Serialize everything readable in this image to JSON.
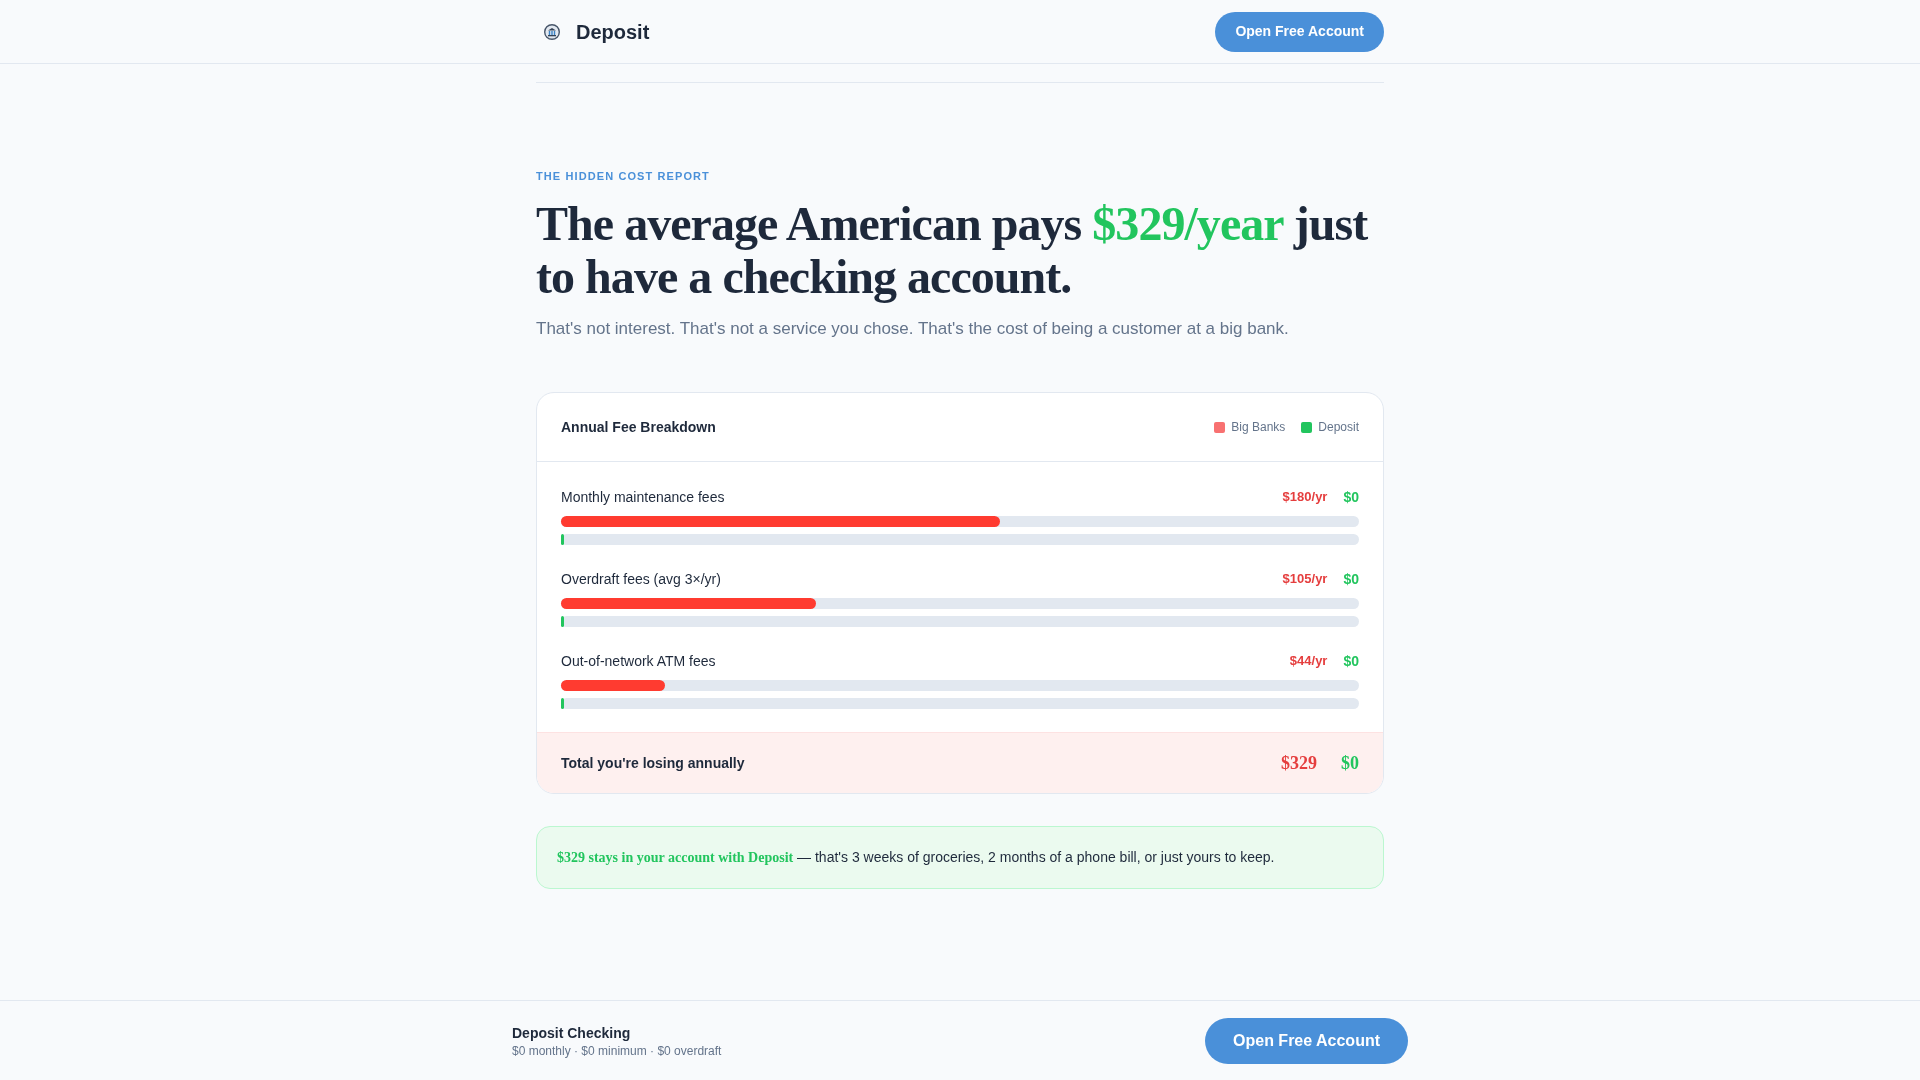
{
  "header": {
    "brand": "Deposit",
    "cta": "Open Free Account"
  },
  "hero": {
    "eyebrow": "THE HIDDEN COST REPORT",
    "headline_start": "The average American pays",
    "headline_highlight": "$329/year",
    "headline_end": "just to have a checking account.",
    "subtitle": "That's not interest. That's not a service you chose. That's the cost of being a customer at a big bank."
  },
  "breakdown": {
    "title": "Annual Fee Breakdown",
    "legend": [
      {
        "label": "Big Banks",
        "color": "#f87171"
      },
      {
        "label": "Deposit",
        "color": "#22c55e"
      }
    ],
    "rows": [
      {
        "label": "Monthly maintenance fees",
        "big_banks": {
          "amount": "$180/yr",
          "level": 0.55
        },
        "deposit": {
          "amount": "$0",
          "level": 0
        }
      },
      {
        "label": "Overdraft fees (avg 3×/yr)",
        "big_banks": {
          "amount": "$105/yr",
          "level": 0.32
        },
        "deposit": {
          "amount": "$0",
          "level": 0
        }
      },
      {
        "label": "Out-of-network ATM fees",
        "big_banks": {
          "amount": "$44/yr",
          "level": 0.13
        },
        "deposit": {
          "amount": "$0",
          "level": 0
        }
      }
    ],
    "total": {
      "label": "Total you're losing annually",
      "big_banks": "$329",
      "deposit": "$0"
    }
  },
  "callout": {
    "highlight": "$329 stays in your account with Deposit",
    "text": "— that's 3 weeks of groceries, 2 months of a phone bill, or just yours to keep."
  },
  "footer": {
    "product": "Deposit Checking",
    "details": "$0 monthly · $0 minimum · $0 overdraft",
    "cta": "Open Free Account"
  }
}
